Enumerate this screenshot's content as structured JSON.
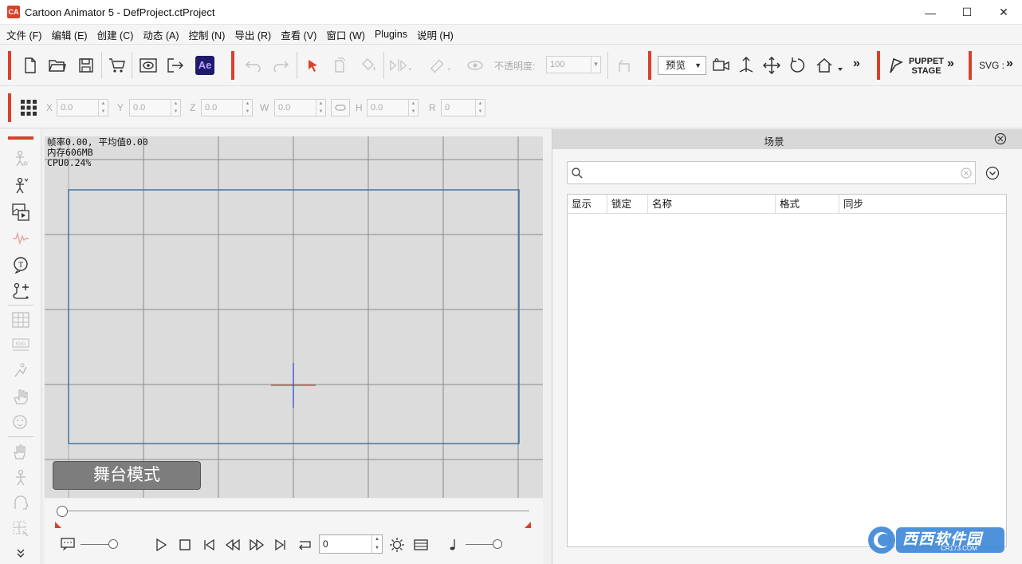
{
  "window": {
    "title": "Cartoon Animator 5 - DefProject.ctProject",
    "controls": [
      "—",
      "☐",
      "✕"
    ]
  },
  "menu": [
    "文件 (F)",
    "编辑 (E)",
    "创建 (C)",
    "动态 (A)",
    "控制 (N)",
    "导出 (R)",
    "查看 (V)",
    "窗口 (W)",
    "Plugins",
    "说明 (H)"
  ],
  "toolbar": {
    "ae_label": "Ae",
    "opacity_label": "不透明度:",
    "opacity_value": "100",
    "preview_label": "预览",
    "puppet_line1": "PUPPET",
    "puppet_line2": "STAGE",
    "svg_label": "SVG :",
    "more": "»"
  },
  "transform": {
    "x_label": "X",
    "x_value": "0.0",
    "y_label": "Y",
    "y_value": "0.0",
    "z_label": "Z",
    "z_value": "0.0",
    "w_label": "W",
    "w_value": "0.0",
    "h_label": "H",
    "h_value": "0.0",
    "r_label": "R",
    "r_value": "0"
  },
  "stage": {
    "stats_fps": "帧率0.00, 平均值0.00",
    "stats_mem": "内存606MB",
    "stats_cpu": "CPU0.24%",
    "mode_label": "舞台模式"
  },
  "timeline": {
    "frame_value": "0"
  },
  "scene": {
    "title": "场景",
    "search_placeholder": "",
    "columns": [
      "显示",
      "锁定",
      "名称",
      "格式",
      "同步"
    ]
  },
  "watermark": {
    "main": "西西软件园",
    "sub": "CR173.COM"
  },
  "colors": {
    "accent": "#d9412b",
    "stage_bg": "#dcdcdc",
    "frame_border": "#3d6e99",
    "ae_badge": "#1f1a6b"
  }
}
